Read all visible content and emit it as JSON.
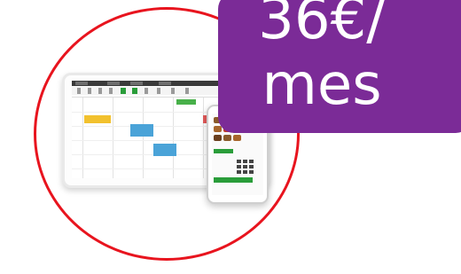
{
  "price": {
    "line1": "36€/",
    "line2": "mes"
  },
  "colors": {
    "badge": "#7b2b97",
    "circle": "#e8141e",
    "accent": "#2a9d3a"
  }
}
